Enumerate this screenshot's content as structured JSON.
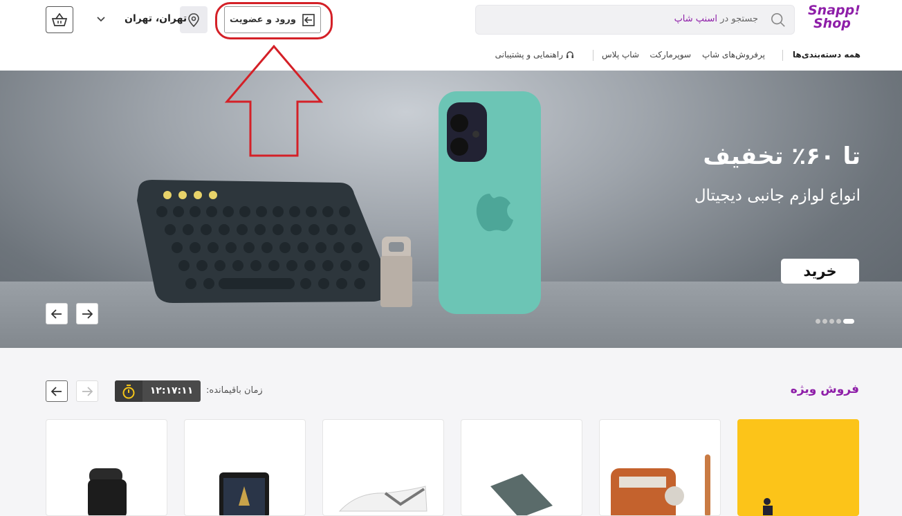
{
  "header": {
    "logo_line1": "Snapp!",
    "logo_line2": "Shop",
    "search_placeholder_prefix": "جستجو در",
    "search_placeholder_brand": "اسنپ شاپ",
    "login_label": "ورود و عضویت",
    "location_label": "تهران، تهران"
  },
  "nav": {
    "all_categories": "همه دسته‌بندی‌ها",
    "items": [
      "پرفروش‌های شاپ",
      "سوپرمارکت",
      "شاپ پلاس",
      "راهنمایی و پشتیبانی"
    ]
  },
  "banner": {
    "headline": "تا ۶۰٪ تخفیف",
    "subline": "انواع لوازم جانبی دیجیتال",
    "buy_label": "خرید",
    "slide_count": 5,
    "active_slide": 1
  },
  "special_sale": {
    "title": "فروش ویژه",
    "timer_label": "زمان باقیمانده:",
    "timer_value": "۱۲:۱۷:۱۱"
  },
  "colors": {
    "brand": "#8e1ea8",
    "annotation": "#d42027",
    "timer_bg": "#4a4a4a",
    "card_highlight": "#fcc419"
  },
  "icons": [
    "search-icon",
    "login-icon",
    "location-icon",
    "chevron-down-icon",
    "cart-icon",
    "arrow-left-icon",
    "arrow-right-icon",
    "stopwatch-icon",
    "support-icon"
  ]
}
